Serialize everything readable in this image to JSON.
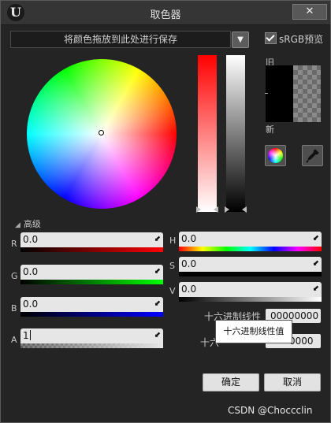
{
  "window": {
    "title": "取色器",
    "close_glyph": "✕",
    "logo_glyph": "U"
  },
  "save_bar": {
    "label": "将颜色拖放到此处进行保存",
    "dropdown_glyph": "▼"
  },
  "srgb_preview": {
    "label": "sRGB预览",
    "checked": true
  },
  "preview": {
    "old_label": "旧",
    "new_label": "新",
    "old_color": "#000000",
    "new_color": "#000000"
  },
  "icons": {
    "wheel_button": "color-wheel-icon",
    "eyedropper_button": "eyedropper-icon"
  },
  "advanced": {
    "label": "高级",
    "expander_glyph": "◢"
  },
  "channels": {
    "R": {
      "label": "R",
      "value": "0.0"
    },
    "G": {
      "label": "G",
      "value": "0.0"
    },
    "B": {
      "label": "B",
      "value": "0.0"
    },
    "A": {
      "label": "A",
      "value": "1"
    },
    "H": {
      "label": "H",
      "value": "0.0"
    },
    "S": {
      "label": "S",
      "value": "0.0"
    },
    "V": {
      "label": "V",
      "value": "0.0"
    }
  },
  "field_arrow_glyph": "⬋",
  "hex": {
    "linear_label": "十六进制线性",
    "linear_value": "00000000",
    "srgb_label_visible": "十六",
    "srgb_value_visible": "0000"
  },
  "tooltip": {
    "text": "十六进制线性值"
  },
  "buttons": {
    "ok": "确定",
    "cancel": "取消"
  },
  "watermark": "CSDN @Choccclin",
  "colors": {
    "window_bg": "#242424",
    "titlebar_bg": "#353535",
    "field_bg": "#e6e6e6"
  }
}
